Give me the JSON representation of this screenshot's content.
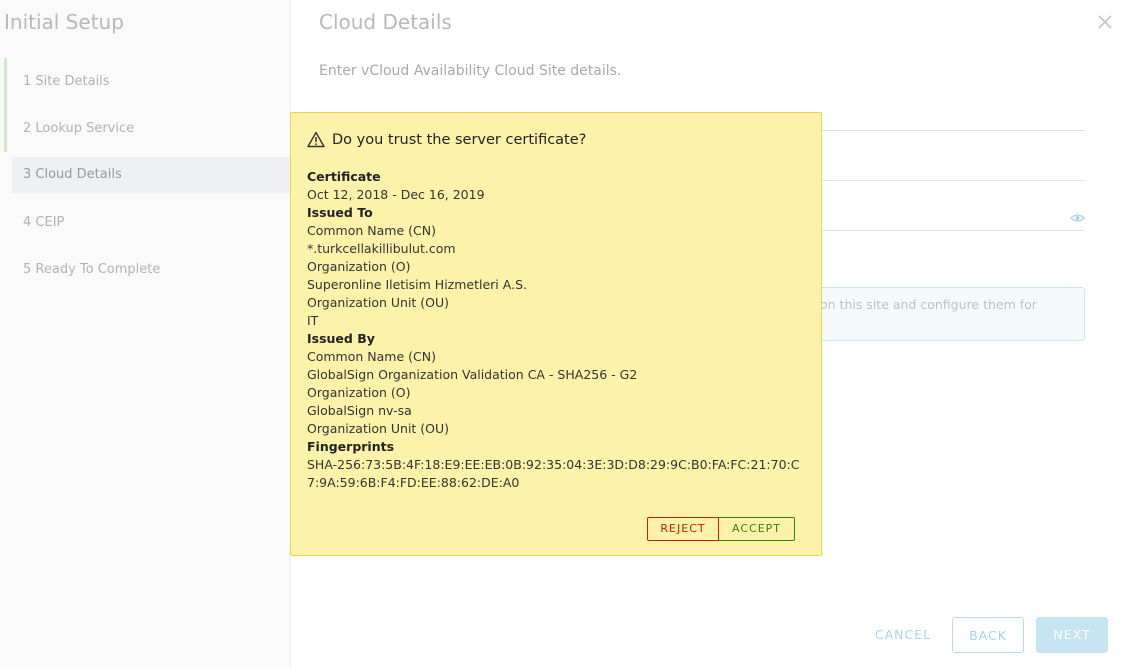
{
  "wizard": {
    "title": "Initial Setup",
    "steps": [
      {
        "label": "1  Site Details"
      },
      {
        "label": "2  Lookup Service"
      },
      {
        "label": "3  Cloud Details"
      },
      {
        "label": "4  CEIP"
      },
      {
        "label": "5  Ready To Complete"
      }
    ]
  },
  "main": {
    "title": "Cloud Details",
    "subtitle": "Enter vCloud Availability Cloud Site details.",
    "info_text": "on this site and configure them for"
  },
  "footer": {
    "cancel_label": "CANCEL",
    "back_label": "BACK",
    "next_label": "NEXT"
  },
  "modal": {
    "title": "Do you trust the server certificate?",
    "certificate_heading": "Certificate",
    "validity": "Oct 12, 2018 - Dec 16, 2019",
    "issued_to_heading": "Issued To",
    "issued_to": {
      "cn_label": "Common Name (CN)",
      "cn_value": "*.turkcellakillibulut.com",
      "o_label": "Organization (O)",
      "o_value": "Superonline Iletisim Hizmetleri A.S.",
      "ou_label": "Organization Unit (OU)",
      "ou_value": "IT"
    },
    "issued_by_heading": "Issued By",
    "issued_by": {
      "cn_label": "Common Name (CN)",
      "cn_value": "GlobalSign Organization Validation CA - SHA256 - G2",
      "o_label": "Organization (O)",
      "o_value": "GlobalSign nv-sa",
      "ou_label": "Organization Unit (OU)"
    },
    "fingerprints_heading": "Fingerprints",
    "fingerprint": "SHA-256:73:5B:4F:18:E9:EE:EB:0B:92:35:04:3E:3D:D8:29:9C:B0:FA:FC:21:70:C7:9A:59:6B:F4:FD:EE:88:62:DE:A0",
    "reject_label": "REJECT",
    "accept_label": "ACCEPT"
  }
}
